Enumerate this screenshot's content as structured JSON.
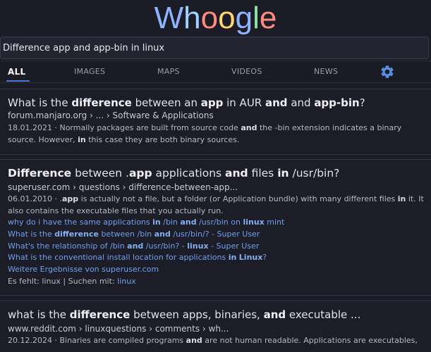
{
  "logo": {
    "letters": [
      "W",
      "h",
      "o",
      "o",
      "g",
      "l",
      "e"
    ],
    "colors": [
      "#8fb4ff",
      "#9fd2ff",
      "#ff8a80",
      "#ffd66b",
      "#8fb4ff",
      "#8fe3a2",
      "#ff8a80"
    ]
  },
  "search": {
    "value": "Difference app and app-bin in linux"
  },
  "tabs": [
    {
      "label": "ALL",
      "active": true
    },
    {
      "label": "IMAGES",
      "active": false
    },
    {
      "label": "MAPS",
      "active": false
    },
    {
      "label": "VIDEOS",
      "active": false
    },
    {
      "label": "NEWS",
      "active": false
    }
  ],
  "settings_icon": "gear-icon",
  "results": [
    {
      "title_parts": [
        "What is the ",
        "difference",
        " between an ",
        "app",
        " in AUR ",
        "and",
        " and ",
        "app-bin",
        "?"
      ],
      "url": "forum.manjaro.org › ... › Software & Applications",
      "snippet_line1_parts": [
        "18.01.2021 · Normally packages are built from source code ",
        "and",
        " the -bin extension indicates a binary"
      ],
      "snippet_line2_parts": [
        "source. However, ",
        "in",
        " this case they are both binary sources."
      ]
    },
    {
      "title_parts": [
        "Difference",
        " between .",
        "app",
        " applications ",
        "and",
        " files ",
        "in",
        " /usr/bin?"
      ],
      "url": "superuser.com › questions › difference-between-app...",
      "snippet_line1_parts": [
        "06.01.2010 · .",
        "app",
        " is actually not a file, but a folder (or Application bundle) with many different files ",
        "in",
        " it. It"
      ],
      "snippet_line2": "also contains the executable files that you actually run.",
      "sublinks": [
        [
          "why do i have the same applications ",
          "in",
          " /bin ",
          "and",
          " /usr/bin on ",
          "linux",
          " mint"
        ],
        [
          "What is the ",
          "difference",
          " between /bin ",
          "and",
          " /usr/bin/? - Super User"
        ],
        [
          "What's the relationship of /bin ",
          "and",
          " /usr/bin? - ",
          "linux",
          " - Super User"
        ],
        [
          "What is the conventional install location for applications ",
          "in",
          " ",
          "Linux",
          "?"
        ],
        [
          "Weitere Ergebnisse von superuser.com"
        ]
      ],
      "missing_label": "Es fehlt: linux | Suchen mit: ",
      "missing_link": "linux"
    },
    {
      "title_parts": [
        "what is the ",
        "difference",
        " between apps, binaries, ",
        "and",
        " executable ..."
      ],
      "url": "www.reddit.com › linuxquestions › comments › wh...",
      "snippet_line1_parts": [
        "20.12.2024 · Binaries are compiled programs ",
        "and",
        " are not human readable. Applications are executables,"
      ]
    }
  ]
}
